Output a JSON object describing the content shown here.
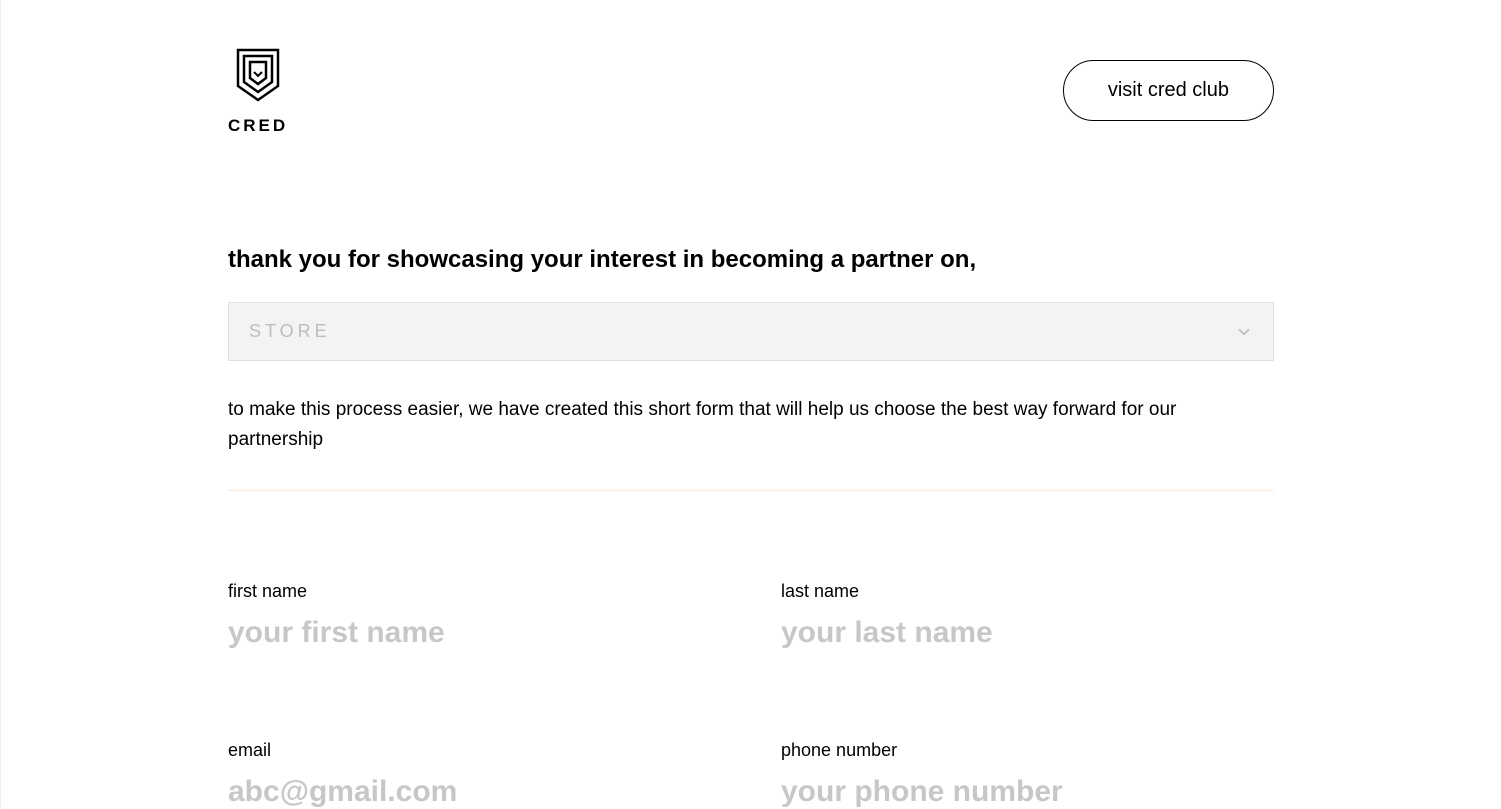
{
  "header": {
    "logo_text": "CRED",
    "visit_button": "visit cred club"
  },
  "intro": {
    "heading": "thank you for showcasing your interest in becoming a partner on,",
    "select_value": "STORE",
    "subtext": "to make this process easier, we have created this short form that will help us choose the best way forward for our partnership"
  },
  "form": {
    "first_name": {
      "label": "first name",
      "placeholder": "your first name",
      "value": ""
    },
    "last_name": {
      "label": "last name",
      "placeholder": "your last name",
      "value": ""
    },
    "email": {
      "label": "email",
      "placeholder": "abc@gmail.com",
      "value": ""
    },
    "phone": {
      "label": "phone number",
      "placeholder": "your phone number",
      "value": ""
    }
  }
}
